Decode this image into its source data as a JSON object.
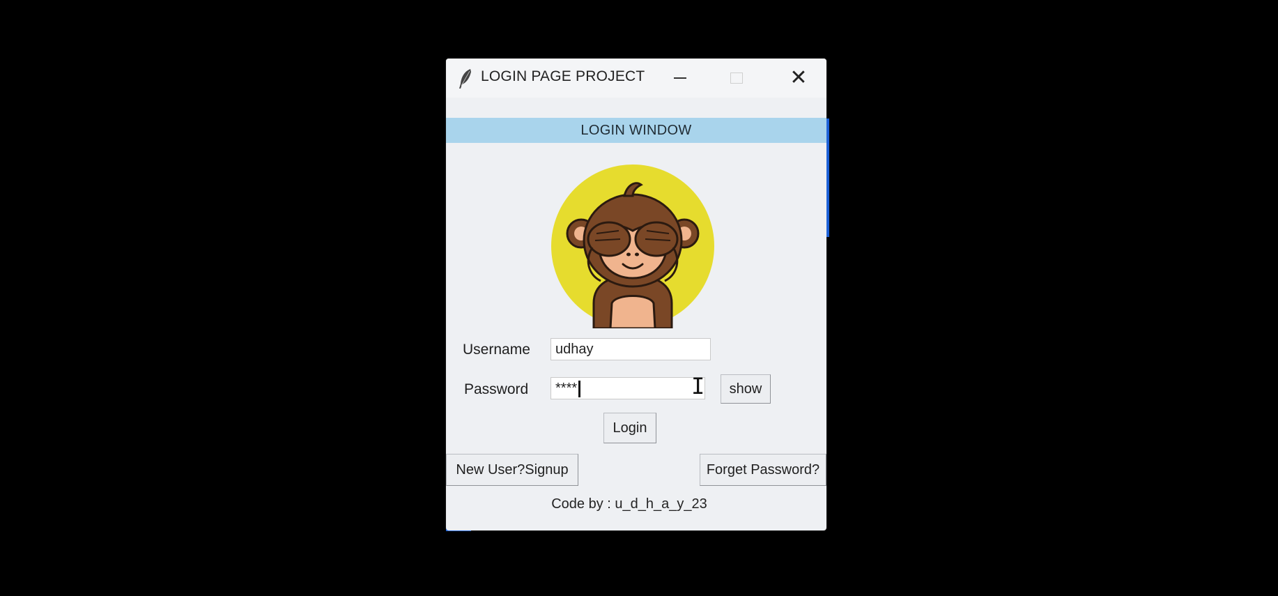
{
  "window": {
    "title": "LOGIN PAGE PROJECT",
    "app_icon": "feather-icon",
    "controls": [
      "minimize-icon",
      "maximize-icon",
      "close-icon"
    ],
    "close_glyph": "✕"
  },
  "banner": {
    "text": "LOGIN WINDOW",
    "color": "#a9d4ec"
  },
  "avatar": {
    "icon": "monkey-covering-eyes-icon",
    "background": "#e6dc2e"
  },
  "form": {
    "username_label": "Username",
    "username_value": "udhay",
    "password_label": "Password",
    "password_value": "****",
    "show_button": "show",
    "login_button": "Login"
  },
  "footer": {
    "signup_button": "New User?Signup",
    "forget_button": "Forget Password?",
    "credit": "Code by : u_d_h_a_y_23"
  },
  "colors": {
    "desktop": "#000000",
    "window_bg": "#eef0f3",
    "accent": "#1a5fd6"
  }
}
